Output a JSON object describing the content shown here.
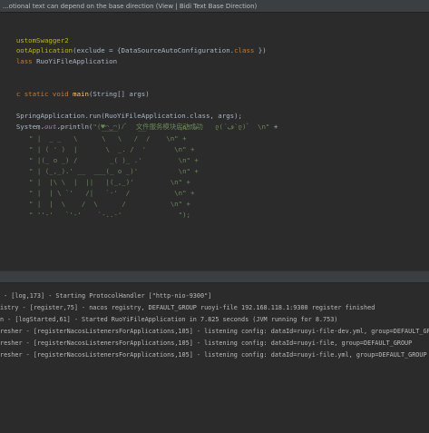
{
  "tooltip": "...otional text can depend on the base direction (View | Bidi Text Base Direction)",
  "code": {
    "l1": "ustomSwagger2",
    "l2a": "ootApplication",
    "l2b": "(exclude = {DataSourceAutoConfiguration.",
    "l2c": "class",
    "l2d": " })",
    "l3a": "lass ",
    "l3b": "RuoYiFileApplication",
    "l4a": "c ",
    "l4b": "static void ",
    "l4c": "main",
    "l4d": "(String[] args)",
    "l5": "SpringApplication.run(RuoYiFileApplication.class, args);",
    "l6a": "System.",
    "l6b": "out",
    "l6c": ".println(",
    "l6d": "\"(♥◠‿◠)ﾉﾞ  文件服务模块启动成功   ლ(´ڡ`ლ)ﾞ  \\n\"",
    "l6e": " +",
    "art": [
      "\" .-------.       ____     __        \\n\" +",
      "\" |  _ _   \\      \\   \\   /  /    \\n\" +",
      "\" | ( ' )  |       \\  _. /  '       \\n\" +",
      "\" |(_ o _) /        _( )_ .'         \\n\" +",
      "\" | (_,_).' __  ___(_ o _)'          \\n\" +",
      "\" |  |\\ \\  |  ||   |(_,_)'         \\n\" +",
      "\" |  | \\ `'   /|   `-'  /           \\n\" +",
      "\" |  |  \\    /  \\      /           \\n\" +",
      "\" ''-'   `'-'    `-..-'              \");"
    ]
  },
  "logs": [
    " - [log,173] - Starting ProtocolHandler [\"http-nio-9300\"]",
    "istry - [register,75] - nacos registry, DEFAULT_GROUP ruoyi-file 192.168.118.1:9300 register finished",
    "n - [logStarted,61] - Started RuoYiFileApplication in 7.825 seconds (JVM running for 8.753)",
    "resher - [registerNacosListenersForApplications,105] - listening config: dataId=ruoyi-file-dev.yml, group=DEFAULT_GROUP",
    "resher - [registerNacosListenersForApplications,105] - listening config: dataId=ruoyi-file, group=DEFAULT_GROUP",
    "resher - [registerNacosListenersForApplications,105] - listening config: dataId=ruoyi-file.yml, group=DEFAULT_GROUP"
  ]
}
